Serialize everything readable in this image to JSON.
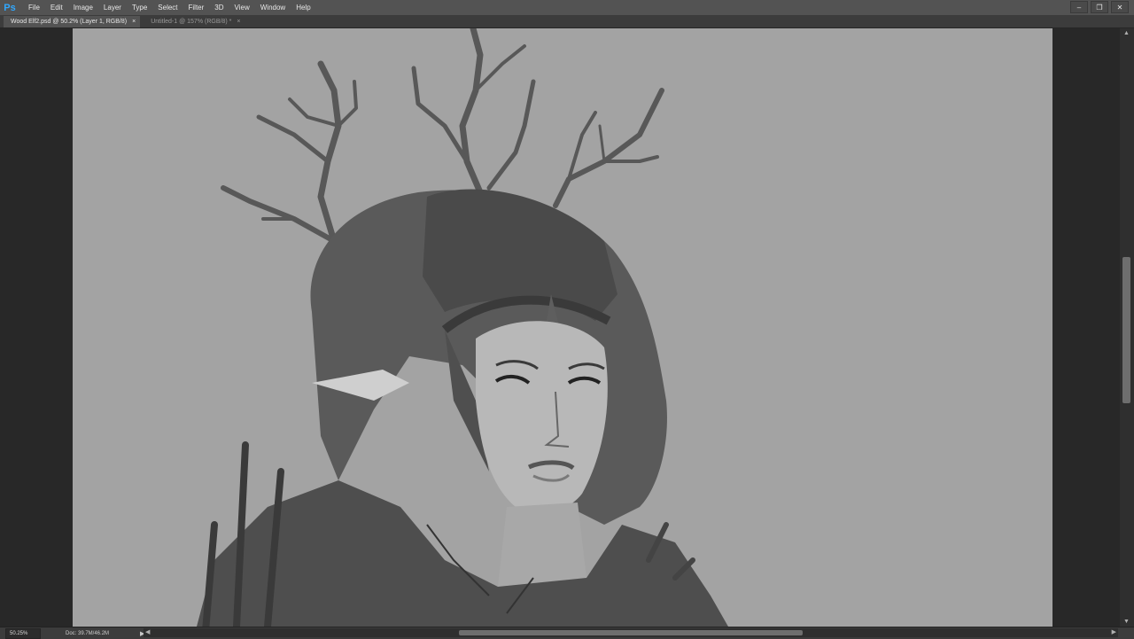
{
  "app": {
    "logo": "Ps"
  },
  "menu": [
    "File",
    "Edit",
    "Image",
    "Layer",
    "Type",
    "Select",
    "Filter",
    "3D",
    "View",
    "Window",
    "Help"
  ],
  "window_controls": {
    "minimize": "–",
    "restore": "❐",
    "close": "✕"
  },
  "tabs": [
    {
      "label": "Wood Elf2.psd @ 50.2% (Layer 1, RGB/8)",
      "close": "×",
      "active": true
    },
    {
      "label": "Untitled-1 @ 157% (RGB/8) *",
      "close": "×",
      "active": false
    }
  ],
  "status": {
    "zoom": "50.25%",
    "doc": "Doc: 39.7M/46.2M",
    "arrow": "▶"
  },
  "scroll": {
    "up": "▲",
    "down": "▼",
    "left": "◀",
    "right": "▶"
  },
  "colors": {
    "canvas_bg": "#a3a3a3",
    "ui_dark": "#282828",
    "menubar": "#535353",
    "logo": "#31a8ff"
  }
}
